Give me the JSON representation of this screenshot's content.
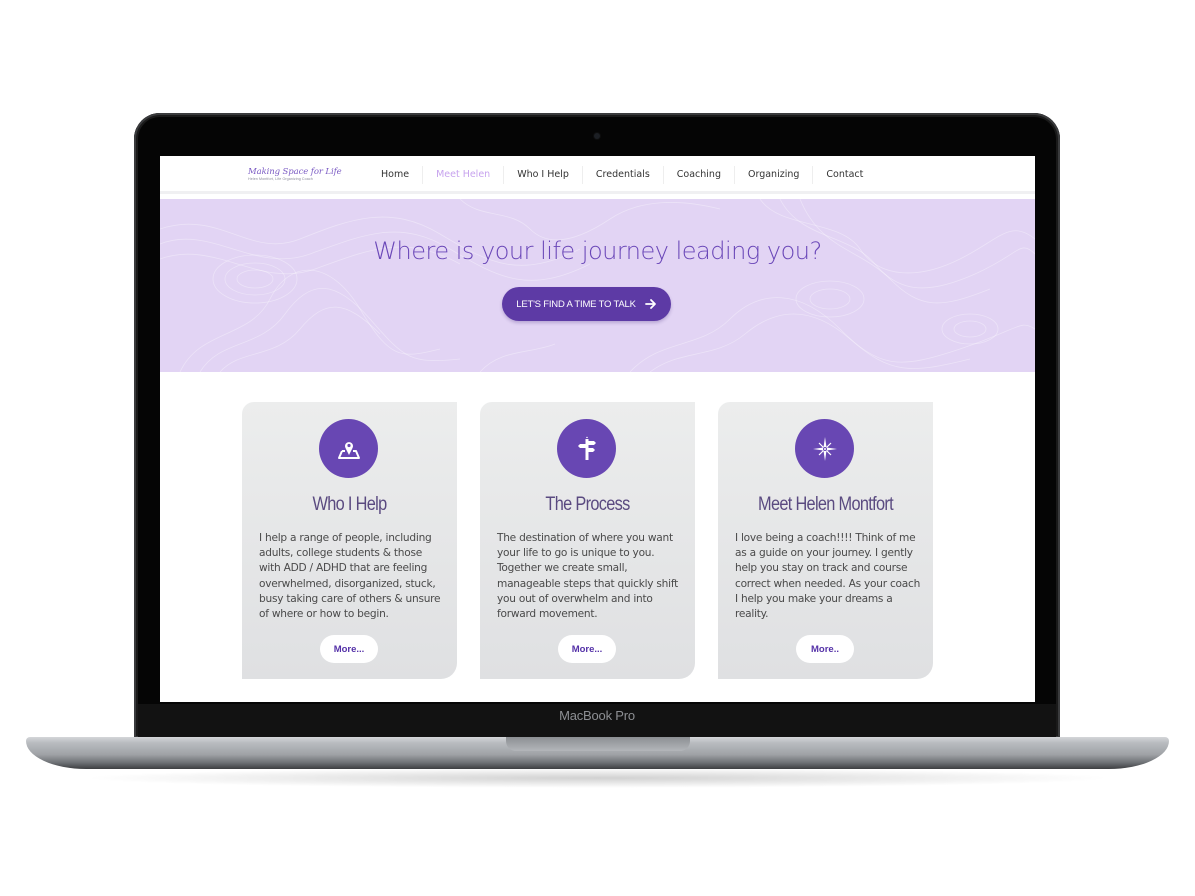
{
  "device": {
    "label": "MacBook Pro"
  },
  "header": {
    "logo": {
      "title": "Making Space for Life",
      "subtitle": "Helen Montfort, Life Organizing Coach"
    },
    "nav": [
      {
        "label": "Home",
        "active": false
      },
      {
        "label": "Meet Helen",
        "active": true
      },
      {
        "label": "Who I Help",
        "active": false
      },
      {
        "label": "Credentials",
        "active": false
      },
      {
        "label": "Coaching",
        "active": false
      },
      {
        "label": "Organizing",
        "active": false
      },
      {
        "label": "Contact",
        "active": false
      }
    ]
  },
  "hero": {
    "title": "Where is your life journey leading you?",
    "cta_label": "LET'S FIND A TIME TO TALK",
    "cta_icon": "arrow-right-icon"
  },
  "cards": [
    {
      "icon": "map-pin-icon",
      "title": "Who I Help",
      "text": "I help a range of people, including adults, college students & those with ADD / ADHD that are feeling overwhelmed, disorganized, stuck, busy taking care of others & unsure of where or how to begin.",
      "button": "More..."
    },
    {
      "icon": "signpost-icon",
      "title": "The Process",
      "text": "The destination of where you want your life to go is unique to you. Together we create small, manageable steps that quickly shift you out of overwhelm and into forward movement.",
      "button": "More..."
    },
    {
      "icon": "compass-star-icon",
      "title": "Meet Helen Montfort",
      "text": "I love being a coach!!!! Think of me as a guide on your journey. I gently help you stay on track and course correct when needed. As your coach I help you make your dreams a reality.",
      "button": "More.."
    }
  ],
  "colors": {
    "brand_purple": "#6847b3",
    "cta_purple": "#5d3aa5",
    "hero_bg": "#e2d4f4",
    "nav_active": "#c7a3ee"
  }
}
